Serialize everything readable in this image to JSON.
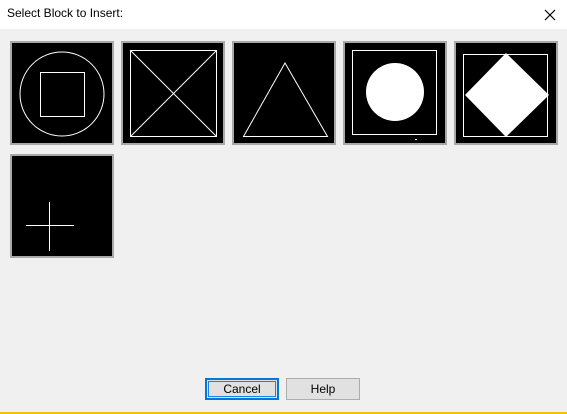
{
  "dialog": {
    "title": "Select Block to Insert:"
  },
  "blocks": [
    {
      "icon": "circle-with-square-block-icon"
    },
    {
      "icon": "square-with-x-block-icon"
    },
    {
      "icon": "triangle-block-icon"
    },
    {
      "icon": "filled-circle-in-square-block-icon"
    },
    {
      "icon": "filled-diamond-in-square-block-icon"
    },
    {
      "icon": "crosshair-block-icon"
    }
  ],
  "buttons": {
    "cancel_label": "Cancel",
    "help_label": "Help"
  },
  "colors": {
    "tile_background": "#000000",
    "tile_border": "#a8a8a8",
    "drawing_stroke": "#ffffff",
    "default_button_border": "#0078d7",
    "dialog_background": "#f0f0f0"
  }
}
